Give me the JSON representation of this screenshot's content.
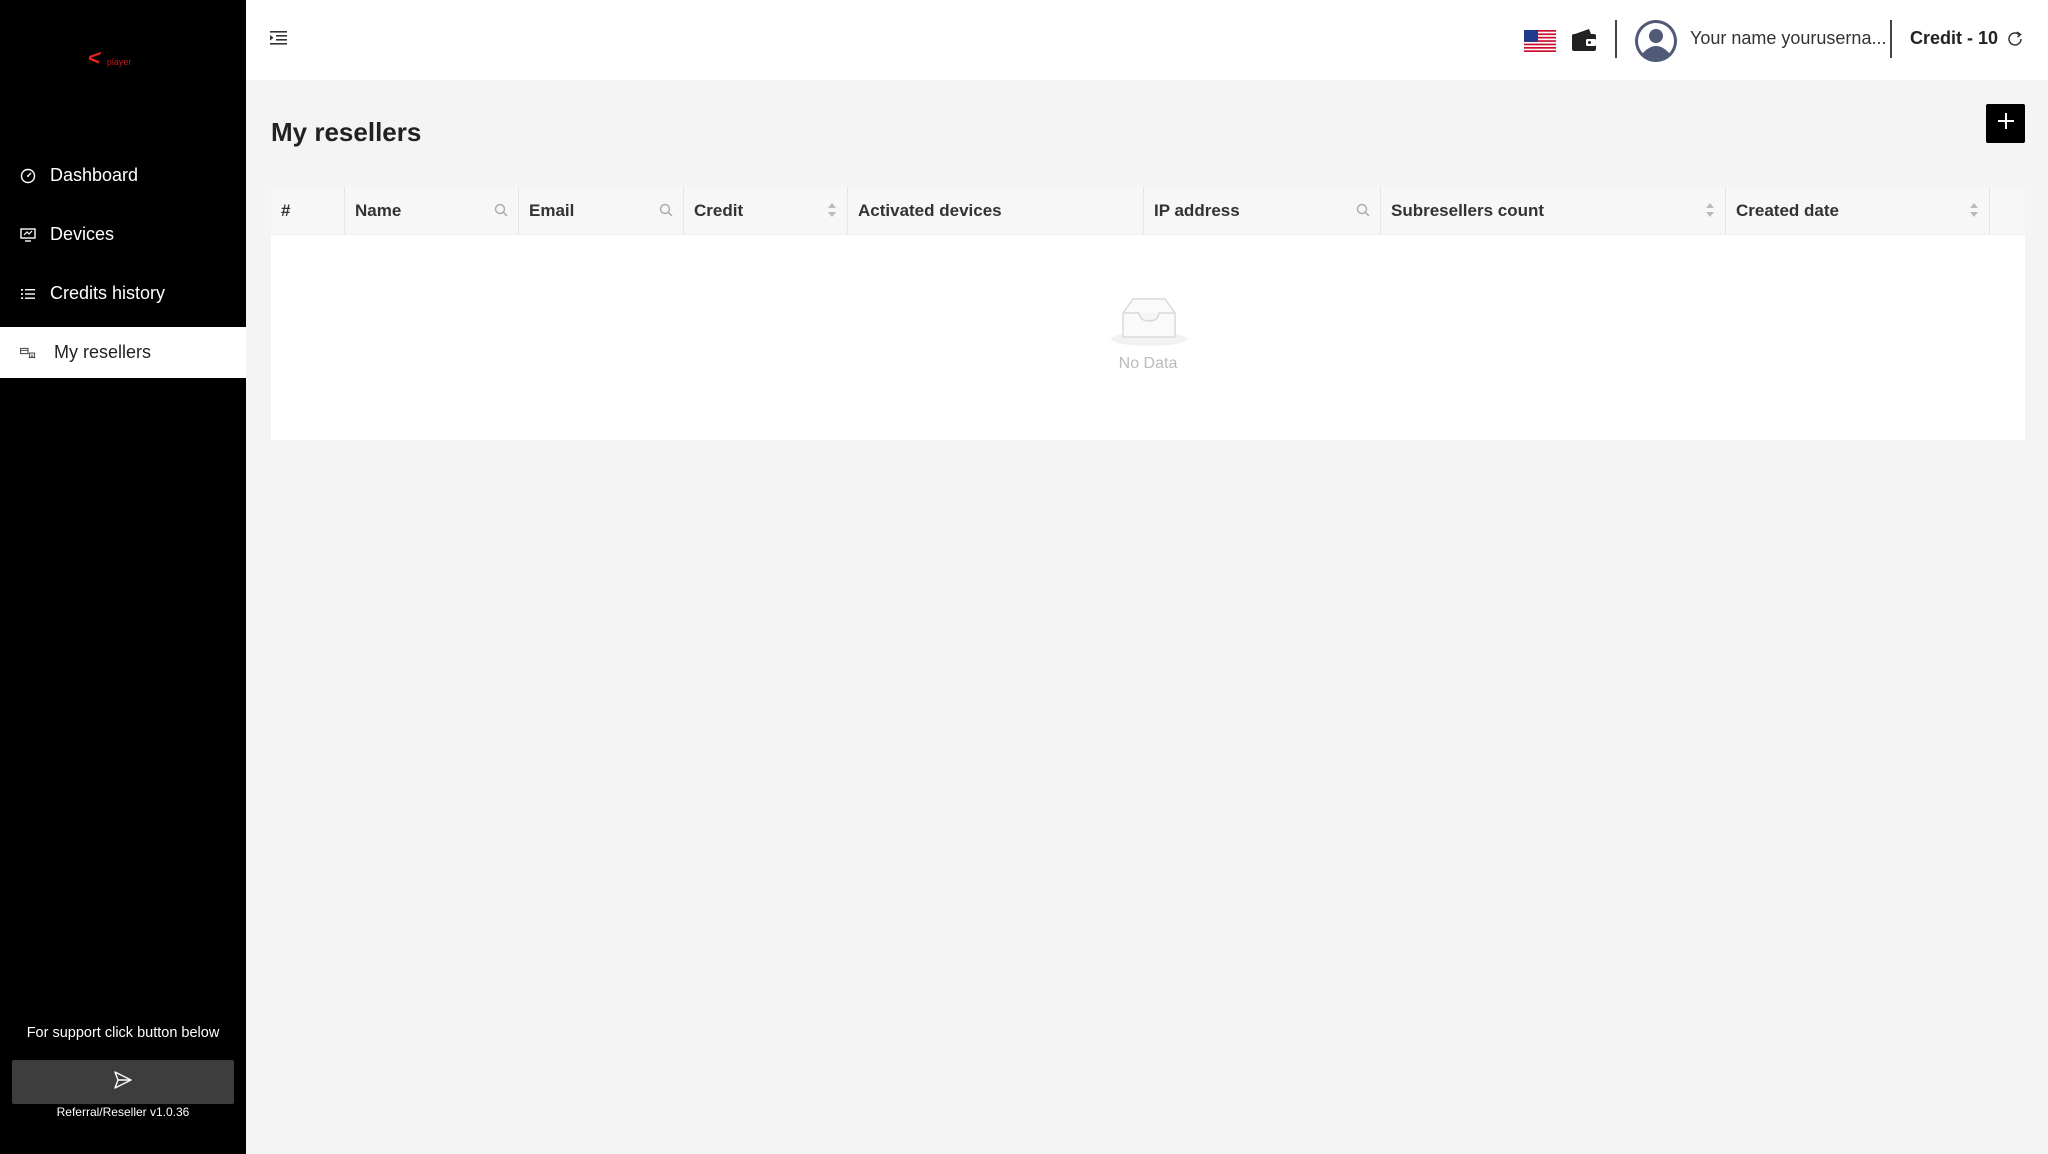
{
  "brand": {
    "mark": "<",
    "text": "player",
    "color": "#e0241b"
  },
  "sidebar": {
    "items": [
      {
        "label": "Dashboard",
        "icon": "dashboard-icon",
        "active": false
      },
      {
        "label": "Devices",
        "icon": "devices-icon",
        "active": false
      },
      {
        "label": "Credits history",
        "icon": "list-icon",
        "active": false
      },
      {
        "label": "My resellers",
        "icon": "resellers-icon",
        "active": true
      }
    ],
    "support_text": "For support click button below",
    "support_icon": "send-icon",
    "version": "Referral/Reseller v1.0.36"
  },
  "header": {
    "menu_icon": "menu-toggle-icon",
    "language_flag": "us-flag-icon",
    "wallet_icon": "wallet-icon",
    "username": "Your name yourusernа...",
    "credit": "Credit - 10",
    "refresh_icon": "refresh-icon"
  },
  "main": {
    "title": "My resellers",
    "add_icon": "plus-icon",
    "table": {
      "columns": [
        {
          "label": "#",
          "tool": "none"
        },
        {
          "label": "Name",
          "tool": "search"
        },
        {
          "label": "Email",
          "tool": "search"
        },
        {
          "label": "Credit",
          "tool": "sort"
        },
        {
          "label": "Activated devices",
          "tool": "none"
        },
        {
          "label": "IP address",
          "tool": "search"
        },
        {
          "label": "Subresellers count",
          "tool": "sort"
        },
        {
          "label": "Created date",
          "tool": "sort"
        },
        {
          "label": "",
          "tool": "none"
        }
      ],
      "rows": [],
      "empty_text": "No Data"
    }
  },
  "colors": {
    "sidebar_bg": "#000000",
    "accent": "#000000",
    "brand_red": "#e0241b",
    "page_bg": "#f4f4f4"
  }
}
